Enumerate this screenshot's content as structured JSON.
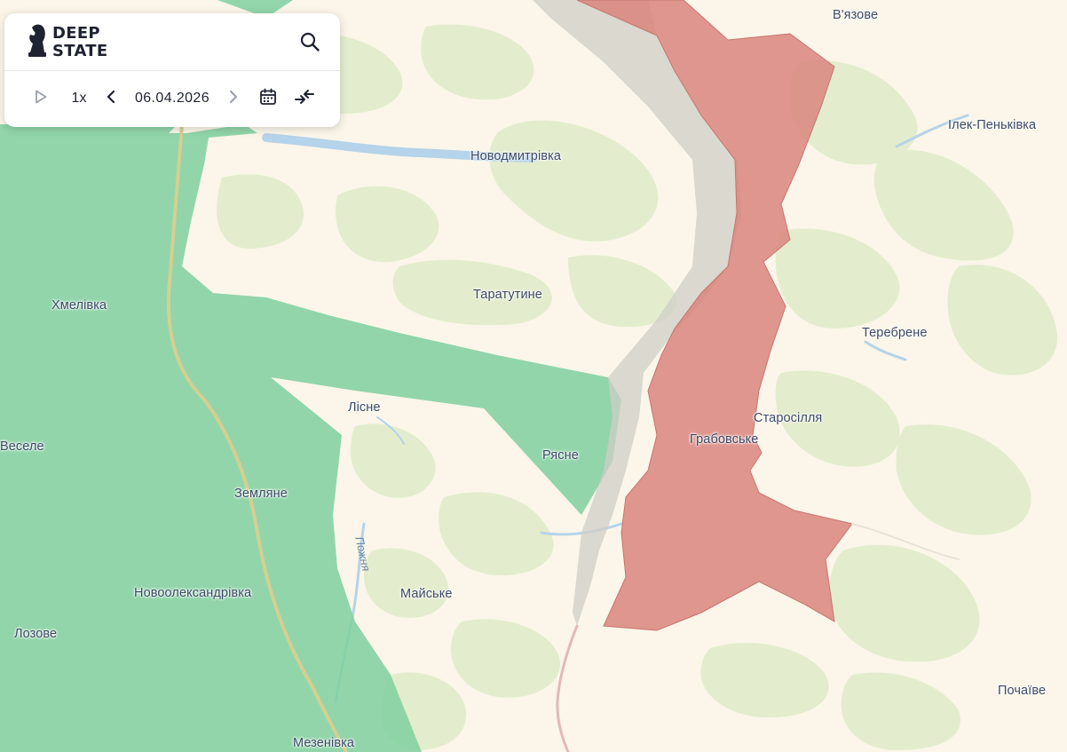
{
  "app": {
    "brand_line1": "DEEP",
    "brand_line2": "STATE"
  },
  "toolbar": {
    "play_icon": "play-icon",
    "speed": "1x",
    "prev_icon": "chevron-left-icon",
    "date": "06.04.2026",
    "next_icon": "chevron-right-icon",
    "calendar_icon": "calendar-icon",
    "compare_icon": "arrows-compare-icon",
    "search_icon": "search-icon"
  },
  "map": {
    "colors": {
      "background": "#fbf6e9",
      "forest": "#e3edcd",
      "controlled_green": "#7fcf9f",
      "occupied_red": "#d9857e",
      "contested_gray": "#cfcdc6",
      "water": "#b5d3ea"
    },
    "places": {
      "vyazove": "В'язове",
      "ilek_penkivka": "Ілек-Пеньківка",
      "novodmytrivka": "Новодмитрівка",
      "taratutyne": "Таратутине",
      "khmelivka": "Хмелівка",
      "terebrene": "Теребрене",
      "lisne": "Лісне",
      "starosillya": "Старосілля",
      "hrabovske": "Грабовське",
      "vesele": "Веселе",
      "ryasne": "Рясне",
      "zemlyane": "Земляне",
      "novooleksandrivka": "Новоолександрівка",
      "mayske": "Майське",
      "lozove": "Лозове",
      "pochayive": "Почаїве",
      "mezenivka": "Мезенівка"
    },
    "rivers": {
      "pozhnya": "Пожня"
    }
  }
}
